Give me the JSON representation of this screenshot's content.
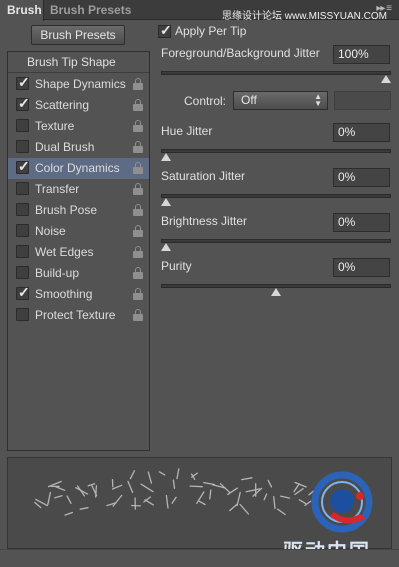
{
  "tabs": [
    {
      "label": "Brush",
      "active": true
    },
    {
      "label": "Brush Presets",
      "active": false
    }
  ],
  "watermark": "思缘设计论坛 www.MISSYUAN.COM",
  "presets_button": "Brush Presets",
  "list": {
    "header": "Brush Tip Shape",
    "items": [
      {
        "label": "Shape Dynamics",
        "checked": true,
        "locked": true,
        "selected": false
      },
      {
        "label": "Scattering",
        "checked": true,
        "locked": true,
        "selected": false
      },
      {
        "label": "Texture",
        "checked": false,
        "locked": true,
        "selected": false
      },
      {
        "label": "Dual Brush",
        "checked": false,
        "locked": true,
        "selected": false
      },
      {
        "label": "Color Dynamics",
        "checked": true,
        "locked": true,
        "selected": true
      },
      {
        "label": "Transfer",
        "checked": false,
        "locked": true,
        "selected": false
      },
      {
        "label": "Brush Pose",
        "checked": false,
        "locked": true,
        "selected": false
      },
      {
        "label": "Noise",
        "checked": false,
        "locked": true,
        "selected": false
      },
      {
        "label": "Wet Edges",
        "checked": false,
        "locked": true,
        "selected": false
      },
      {
        "label": "Build-up",
        "checked": false,
        "locked": true,
        "selected": false
      },
      {
        "label": "Smoothing",
        "checked": true,
        "locked": true,
        "selected": false
      },
      {
        "label": "Protect Texture",
        "checked": false,
        "locked": true,
        "selected": false
      }
    ]
  },
  "settings": {
    "apply_per_tip": {
      "label": "Apply Per Tip",
      "checked": true
    },
    "fg_bg_jitter": {
      "label": "Foreground/Background Jitter",
      "value": "100%",
      "level": 1.0
    },
    "control": {
      "label": "Control:",
      "value": "Off"
    },
    "hue_jitter": {
      "label": "Hue Jitter",
      "value": "0%",
      "level": 0.0
    },
    "saturation_jitter": {
      "label": "Saturation Jitter",
      "value": "0%",
      "level": 0.0
    },
    "brightness_jitter": {
      "label": "Brightness Jitter",
      "value": "0%",
      "level": 0.0
    },
    "purity": {
      "label": "Purity",
      "value": "0%",
      "level": 0.5
    }
  },
  "logo_text": "驱动中国",
  "colors": {
    "panel_bg": "#535353",
    "selection": "#5d6c84",
    "logo_blue": "#1f5fb8",
    "logo_red": "#d8262c"
  }
}
